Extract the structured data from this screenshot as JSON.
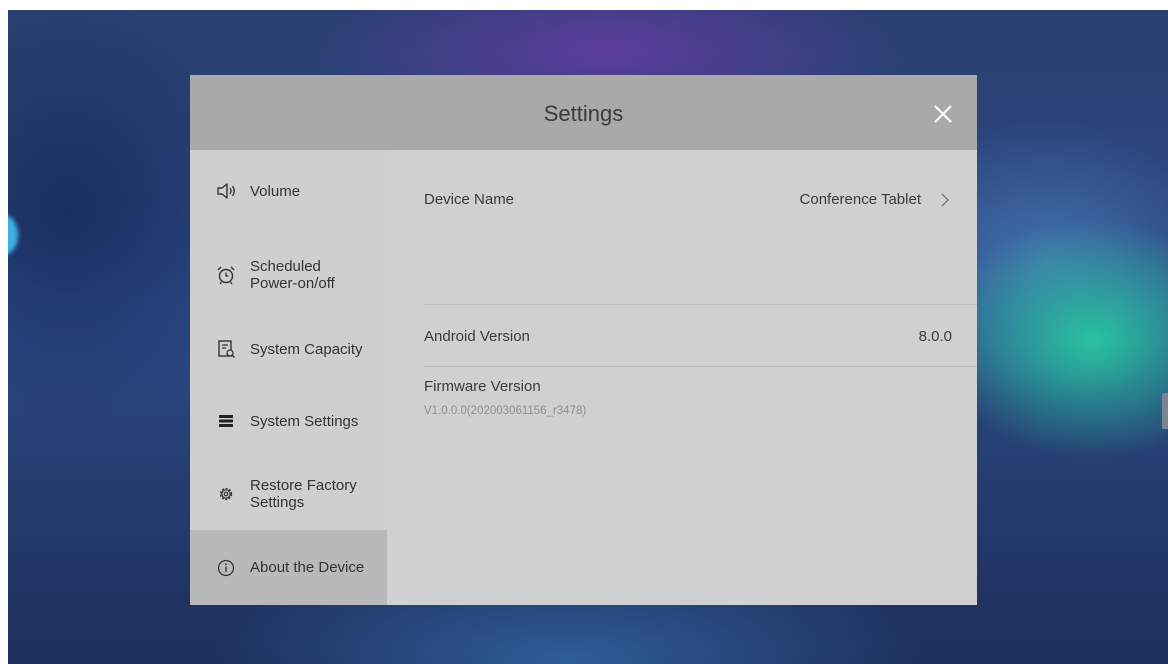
{
  "dialog": {
    "title": "Settings",
    "close_icon": "close-icon"
  },
  "sidebar": {
    "items": [
      {
        "label": "Volume",
        "icon": "speaker-icon",
        "selected": false
      },
      {
        "label": "Scheduled Power-on/off",
        "icon": "alarm-clock-icon",
        "selected": false
      },
      {
        "label": "System Capacity",
        "icon": "storage-icon",
        "selected": false
      },
      {
        "label": "System Settings",
        "icon": "list-settings-icon",
        "selected": false
      },
      {
        "label": "Restore Factory Settings",
        "icon": "gear-icon",
        "selected": false
      },
      {
        "label": "About the Device",
        "icon": "info-icon",
        "selected": true
      }
    ]
  },
  "about": {
    "device_name_label": "Device Name",
    "device_name_value": "Conference Tablet",
    "android_version_label": "Android Version",
    "android_version_value": "8.0.0",
    "firmware_version_label": "Firmware Version",
    "firmware_version_value": "V1.0.0.0(202003061156_r3478)"
  },
  "colors": {
    "header_bg": "#a9a9a9",
    "panel_bg": "#d0d0d0",
    "selected_bg": "#b9b9b9",
    "text": "#333333",
    "close_icon": "#ffffff"
  }
}
